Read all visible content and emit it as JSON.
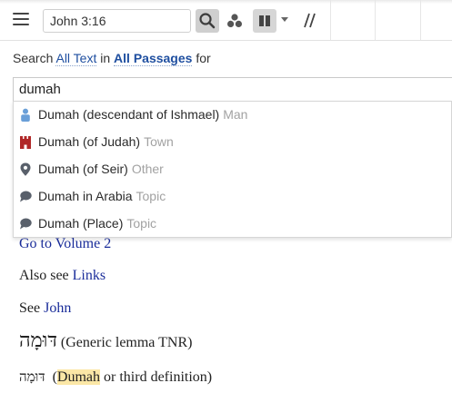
{
  "toolbar": {
    "reference_value": "John 3:16"
  },
  "search_line": {
    "prefix": "Search",
    "scope_text": "All Text",
    "in_word": "in",
    "scope_passages": "All Passages",
    "suffix": "for"
  },
  "query": {
    "value": "dumah"
  },
  "suggestions": [
    {
      "label": "Dumah (descendant of Ishmael)",
      "type": "Man",
      "icon": "person-icon",
      "color": "#6a9fd8"
    },
    {
      "label": "Dumah (of Judah)",
      "type": "Town",
      "icon": "castle-icon",
      "color": "#b02828"
    },
    {
      "label": "Dumah (of Seir)",
      "type": "Other",
      "icon": "map-pin-icon",
      "color": "#59606b"
    },
    {
      "label": "Dumah in Arabia",
      "type": "Topic",
      "icon": "speech-bubble-icon",
      "color": "#59606b"
    },
    {
      "label": "Dumah (Place)",
      "type": "Topic",
      "icon": "speech-bubble-icon",
      "color": "#59606b"
    }
  ],
  "content": {
    "volume_link": "Go to Volume 2",
    "also_see_prefix": "Also see",
    "also_see_link": "Links",
    "see_prefix": "See",
    "see_link": "John",
    "lemma_hebrew": "דּוּמָה",
    "lemma_note": "(Generic lemma TNR)",
    "def_hebrew": "דּוּמָה",
    "def_open": "(",
    "def_highlight": "Dumah",
    "def_rest": "or third definition)"
  },
  "colors": {
    "link": "#1f4fa0",
    "serif_link": "#1a2d9a",
    "highlight": "#fbe7a6",
    "type_gray": "#a2a2a2"
  }
}
